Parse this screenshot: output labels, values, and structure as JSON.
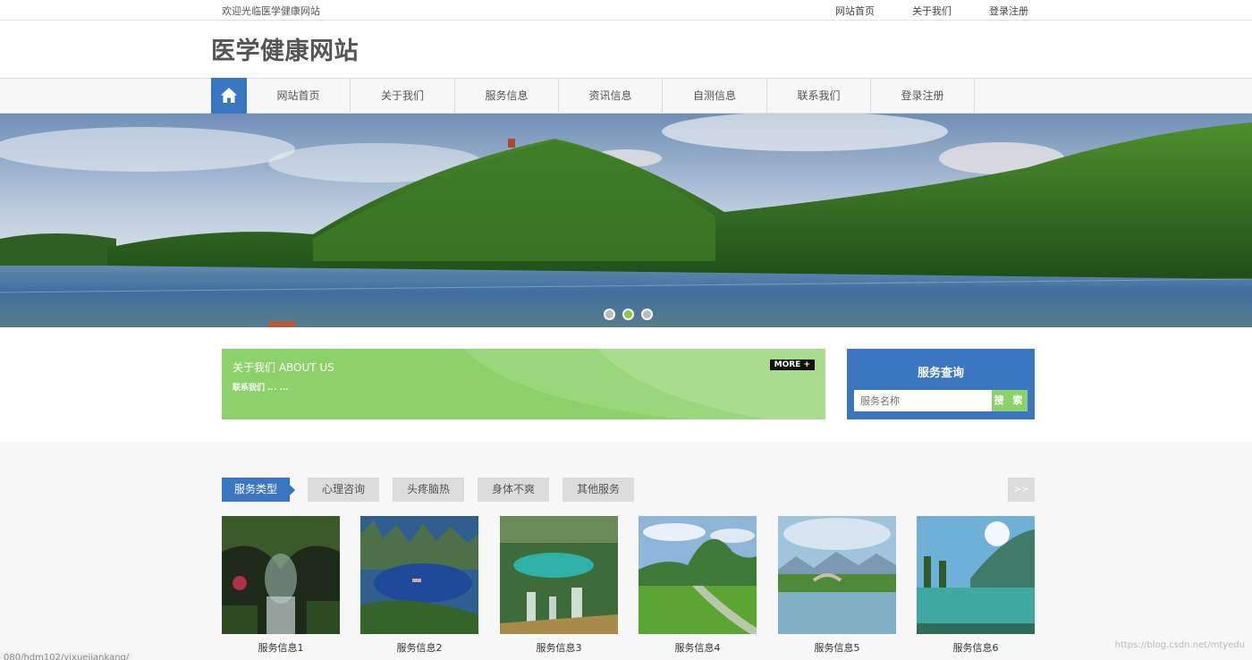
{
  "topbar": {
    "welcome": "欢迎光临医学健康网站",
    "links": [
      "网站首页",
      "关于我们",
      "登录注册"
    ]
  },
  "header": {
    "title": "医学健康网站"
  },
  "nav": {
    "home_icon": "home-icon",
    "items": [
      "网站首页",
      "关于我们",
      "服务信息",
      "资讯信息",
      "自测信息",
      "联系我们",
      "登录注册"
    ]
  },
  "banner": {
    "active_slide": 2,
    "slide_count": 3
  },
  "about": {
    "title": "关于我们 ABOUT US",
    "text": "联系我们 ... ...",
    "more": "MORE +"
  },
  "search": {
    "title": "服务查询",
    "placeholder": "服务名称",
    "button": "搜 索"
  },
  "services": {
    "tabs": [
      "服务类型",
      "心理咨询",
      "头疼脑热",
      "身体不爽",
      "其他服务"
    ],
    "next": ">>",
    "cards": [
      "服务信息1",
      "服务信息2",
      "服务信息3",
      "服务信息4",
      "服务信息5",
      "服务信息6"
    ]
  },
  "statusbar": {
    "url": "080/hdm102/yixuejiankang/"
  },
  "watermark": "https://blog.csdn.net/mtyedu",
  "colors": {
    "primary": "#3a76c2",
    "accent": "#8dd16a"
  }
}
